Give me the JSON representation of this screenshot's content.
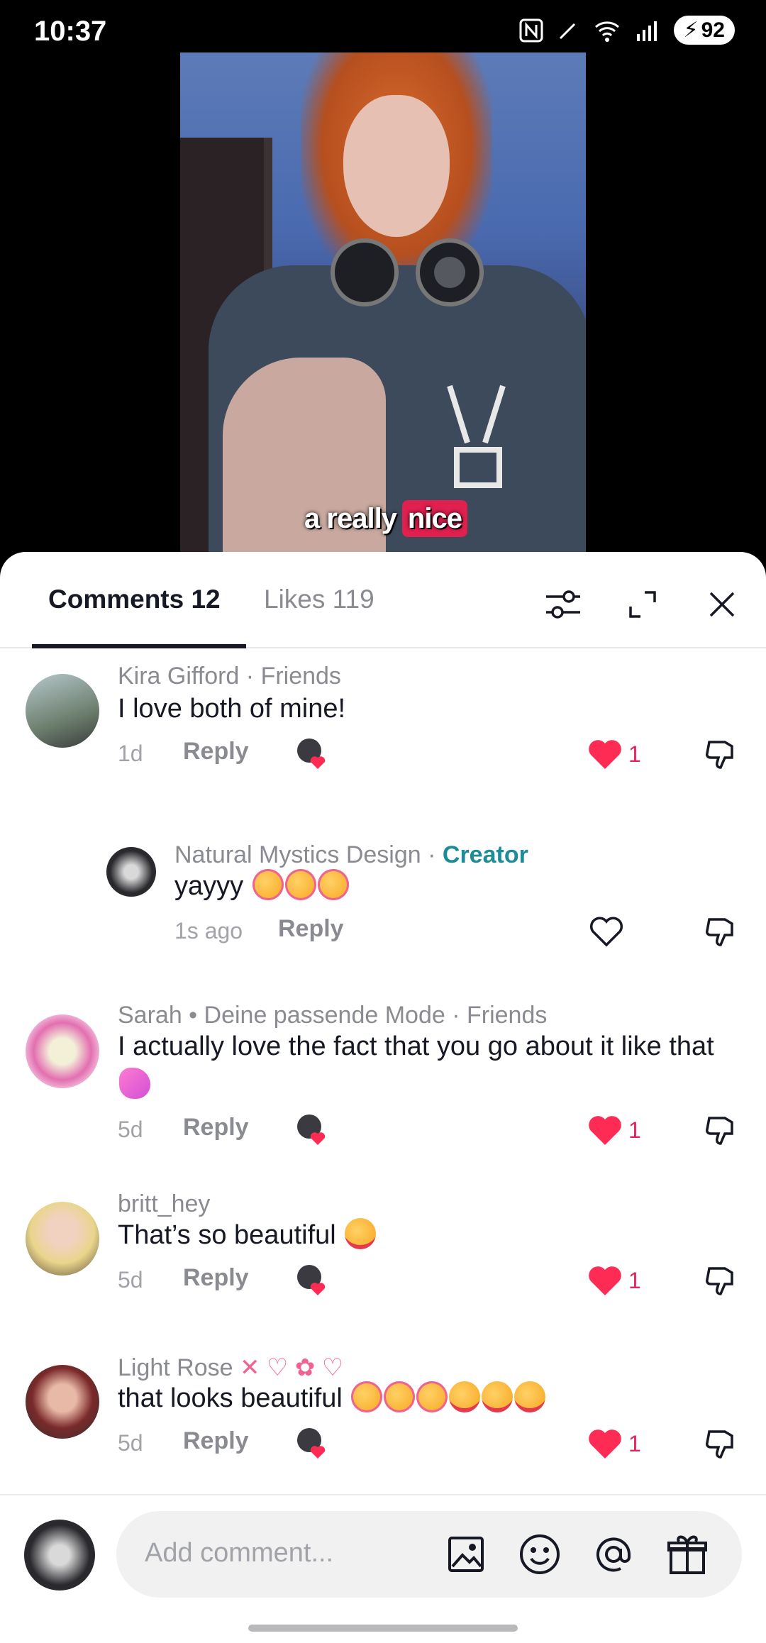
{
  "status": {
    "time": "10:37",
    "battery": "92"
  },
  "video": {
    "caption_part1": "a really",
    "caption_part2": "nice"
  },
  "tabs": {
    "comments": "Comments 12",
    "likes": "Likes 119"
  },
  "comments": [
    {
      "name": "Kira Gifford",
      "tag": "Friends",
      "text": "I love both of mine!",
      "time": "1d",
      "reply": "Reply",
      "likes": "1"
    },
    {
      "name": "Natural Mystics Design",
      "tag": "Creator",
      "text": "yayyy",
      "time": "1s ago",
      "reply": "Reply"
    },
    {
      "name": "Sarah • Deine passende Mode",
      "tag": "Friends",
      "text": "I actually love the fact that you go about it like that",
      "time": "5d",
      "reply": "Reply",
      "likes": "1"
    },
    {
      "name": "britt_hey",
      "text": "That’s so beautiful",
      "time": "5d",
      "reply": "Reply",
      "likes": "1"
    },
    {
      "name": "Light Rose",
      "text": "that looks beautiful",
      "time": "5d",
      "reply": "Reply",
      "likes": "1"
    }
  ],
  "separator": "·",
  "composer": {
    "placeholder": "Add comment..."
  },
  "colors": {
    "accent_red": "#fe2c55",
    "creator_teal": "#1d8c96",
    "text_gray": "#8a8b91"
  }
}
